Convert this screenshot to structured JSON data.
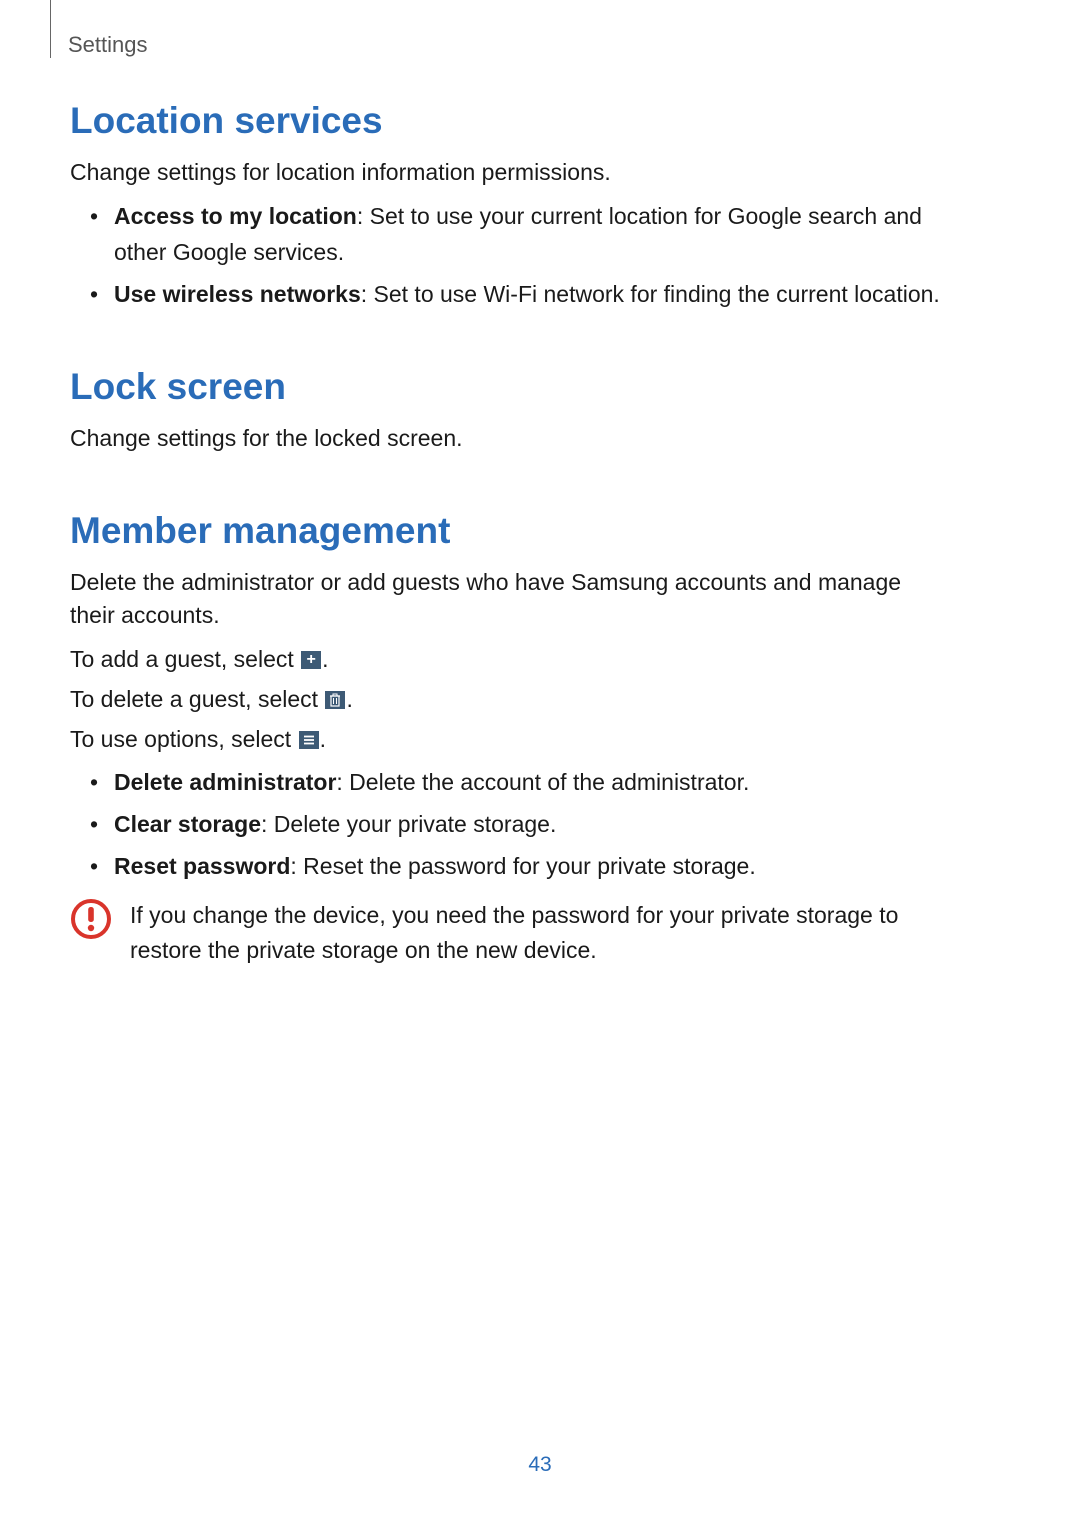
{
  "header": {
    "label": "Settings"
  },
  "sections": {
    "location_services": {
      "title": "Location services",
      "desc": "Change settings for location information permissions.",
      "items": {
        "access_label": "Access to my location",
        "access_desc": ": Set to use your current location for Google search and other Google services.",
        "wireless_label": "Use wireless networks",
        "wireless_desc": ": Set to use Wi-Fi network for finding the current location."
      }
    },
    "lock_screen": {
      "title": "Lock screen",
      "desc": "Change settings for the locked screen."
    },
    "member_management": {
      "title": "Member management",
      "desc": "Delete the administrator or add guests who have Samsung accounts and manage their accounts.",
      "add_guest_pre": "To add a guest, select ",
      "add_guest_post": ".",
      "delete_guest_pre": "To delete a guest, select ",
      "delete_guest_post": ".",
      "use_options_pre": "To use options, select ",
      "use_options_post": ".",
      "items": {
        "delete_admin_label": "Delete administrator",
        "delete_admin_desc": ": Delete the account of the administrator.",
        "clear_storage_label": "Clear storage",
        "clear_storage_desc": ": Delete your private storage.",
        "reset_password_label": "Reset password",
        "reset_password_desc": ": Reset the password for your private storage."
      },
      "caution": "If you change the device, you need the password for your private storage to restore the private storage on the new device."
    }
  },
  "page_number": "43"
}
